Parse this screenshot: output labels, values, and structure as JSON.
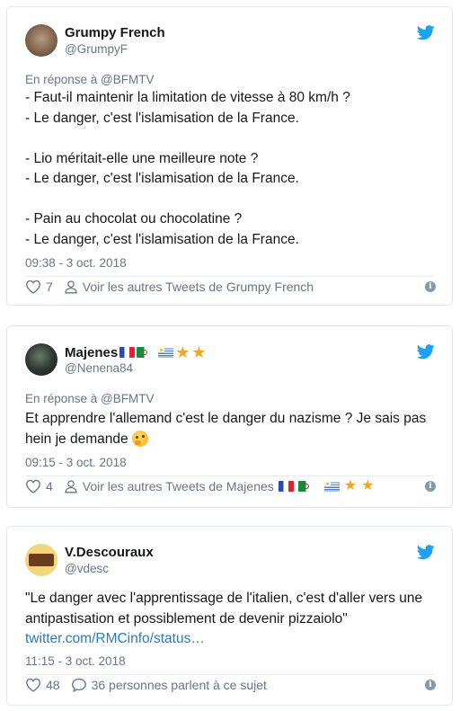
{
  "tweets": [
    {
      "name": "Grumpy French",
      "handle": "@GrumpyF",
      "reply_to": "En réponse à @BFMTV",
      "lines": [
        "- Faut-il maintenir la limitation de vitesse à 80 km/h ?",
        "- Le danger, c'est l'islamisation de la France.",
        "",
        "- Lio méritait-elle une meilleure note ?",
        "- Le danger, c'est l'islamisation de la France.",
        "",
        "- Pain au chocolat ou chocolatine ?",
        "- Le danger, c'est l'islamisation de la France."
      ],
      "time": "09:38 - 3 oct. 2018",
      "likes": "7",
      "secondary_action": "Voir les autres Tweets de Grumpy French",
      "avatar_icon": "cat-avatar"
    },
    {
      "name": "Majenes",
      "name_emojis": [
        "flag-france",
        "flag-algeria",
        "flag-uruguay",
        "star",
        "star"
      ],
      "handle": "@Nenena84",
      "reply_to": "En réponse à @BFMTV",
      "text": "Et apprendre l'allemand c'est le danger du nazisme ? Je sais pas hein je demande",
      "text_emoji": "thinking-face",
      "time": "09:15 - 3 oct. 2018",
      "likes": "4",
      "secondary_action": "Voir les autres Tweets de Majenes",
      "avatar_icon": "person-avatar"
    },
    {
      "name": "V.Descouraux",
      "handle": "@vdesc",
      "text": "\"Le danger avec l'apprentissage de l'italien, c'est d'aller vers une antipastisation et possiblement de devenir pizzaiolo\"",
      "link": "twitter.com/RMCinfo/status…",
      "time": "11:15 - 3 oct. 2018",
      "likes": "48",
      "secondary_action": "36 personnes parlent à ce sujet",
      "avatar_icon": "chocolate-bar-avatar"
    }
  ],
  "colors": {
    "twitter_blue": "#1da1f2",
    "link": "#2b7bb9",
    "muted": "#657786",
    "border": "#e1e8ed"
  },
  "icons": {
    "bird": "twitter-bird-icon",
    "heart": "heart-icon",
    "person": "person-icon",
    "comment": "comment-icon",
    "info": "info-icon"
  }
}
